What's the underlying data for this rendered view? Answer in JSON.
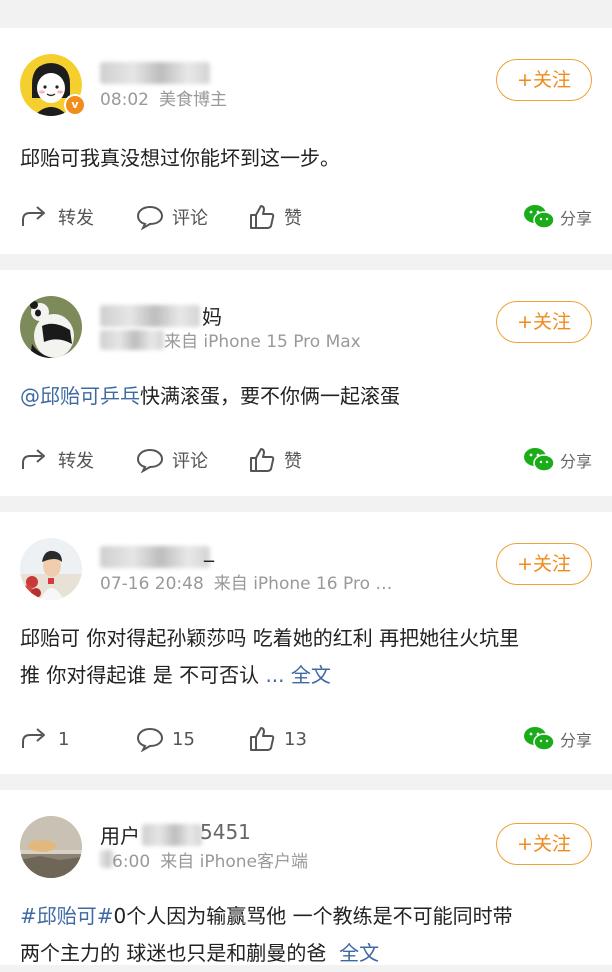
{
  "posts": [
    {
      "name_visible": "",
      "meta_time": "08:02",
      "meta_extra": "美食博主",
      "follow_label": "+关注",
      "text": "邱贻可我真没想过你能坏到这一步。",
      "repost": "转发",
      "comment": "评论",
      "like": "赞",
      "share": "分享"
    },
    {
      "name_tail": "妈",
      "meta_time": "",
      "meta_extra": "来自 iPhone 15 Pro Max",
      "follow_label": "+关注",
      "mention": "@邱贻可乒乓",
      "text": "快满滚蛋，要不你俩一起滚蛋",
      "repost": "转发",
      "comment": "评论",
      "like": "赞",
      "share": "分享"
    },
    {
      "name_tail": "_",
      "meta_time": "07-16 20:48",
      "meta_extra": "来自 iPhone 16 Pro …",
      "follow_label": "+关注",
      "text_line1": "邱贻可 你对得起孙颖莎吗 吃着她的红利 再把她往火坑里",
      "text_line2": "推 你对得起谁 是 不可否认",
      "more": "... 全文",
      "repost": "1",
      "comment": "15",
      "like": "13",
      "share": "分享"
    },
    {
      "name_head": "用户",
      "name_tail": "5451",
      "meta_time": "6:00",
      "meta_extra": "来自 iPhone客户端",
      "follow_label": "+关注",
      "hashtag": "#邱贻可#",
      "text_line1": "0个人因为输赢骂他 一个教练是不可能同时带",
      "text_line2": "两个主力的 球迷也只是和蒯曼的爸",
      "more": "全文"
    }
  ]
}
